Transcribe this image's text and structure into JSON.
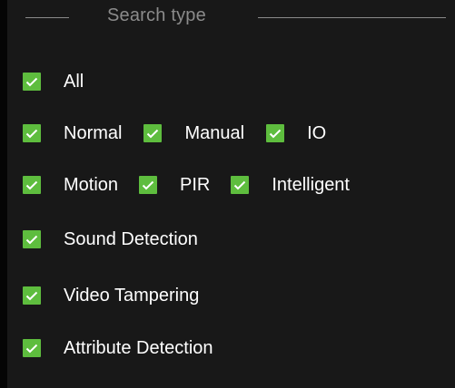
{
  "fieldset": {
    "title": "Search type"
  },
  "options": {
    "all": {
      "label": "All",
      "checked": true
    },
    "normal": {
      "label": "Normal",
      "checked": true
    },
    "manual": {
      "label": "Manual",
      "checked": true
    },
    "io": {
      "label": "IO",
      "checked": true
    },
    "motion": {
      "label": "Motion",
      "checked": true
    },
    "pir": {
      "label": "PIR",
      "checked": true
    },
    "intelligent": {
      "label": "Intelligent",
      "checked": true
    },
    "sound_detection": {
      "label": "Sound Detection",
      "checked": true
    },
    "video_tampering": {
      "label": "Video Tampering",
      "checked": true
    },
    "attribute_detection": {
      "label": "Attribute Detection",
      "checked": true
    }
  },
  "colors": {
    "checkbox": "#5ebd3e",
    "background": "#181818",
    "label_text": "#ffffff",
    "legend_text": "#8b8b8b"
  },
  "icons": {
    "checkmark": "check-icon"
  }
}
